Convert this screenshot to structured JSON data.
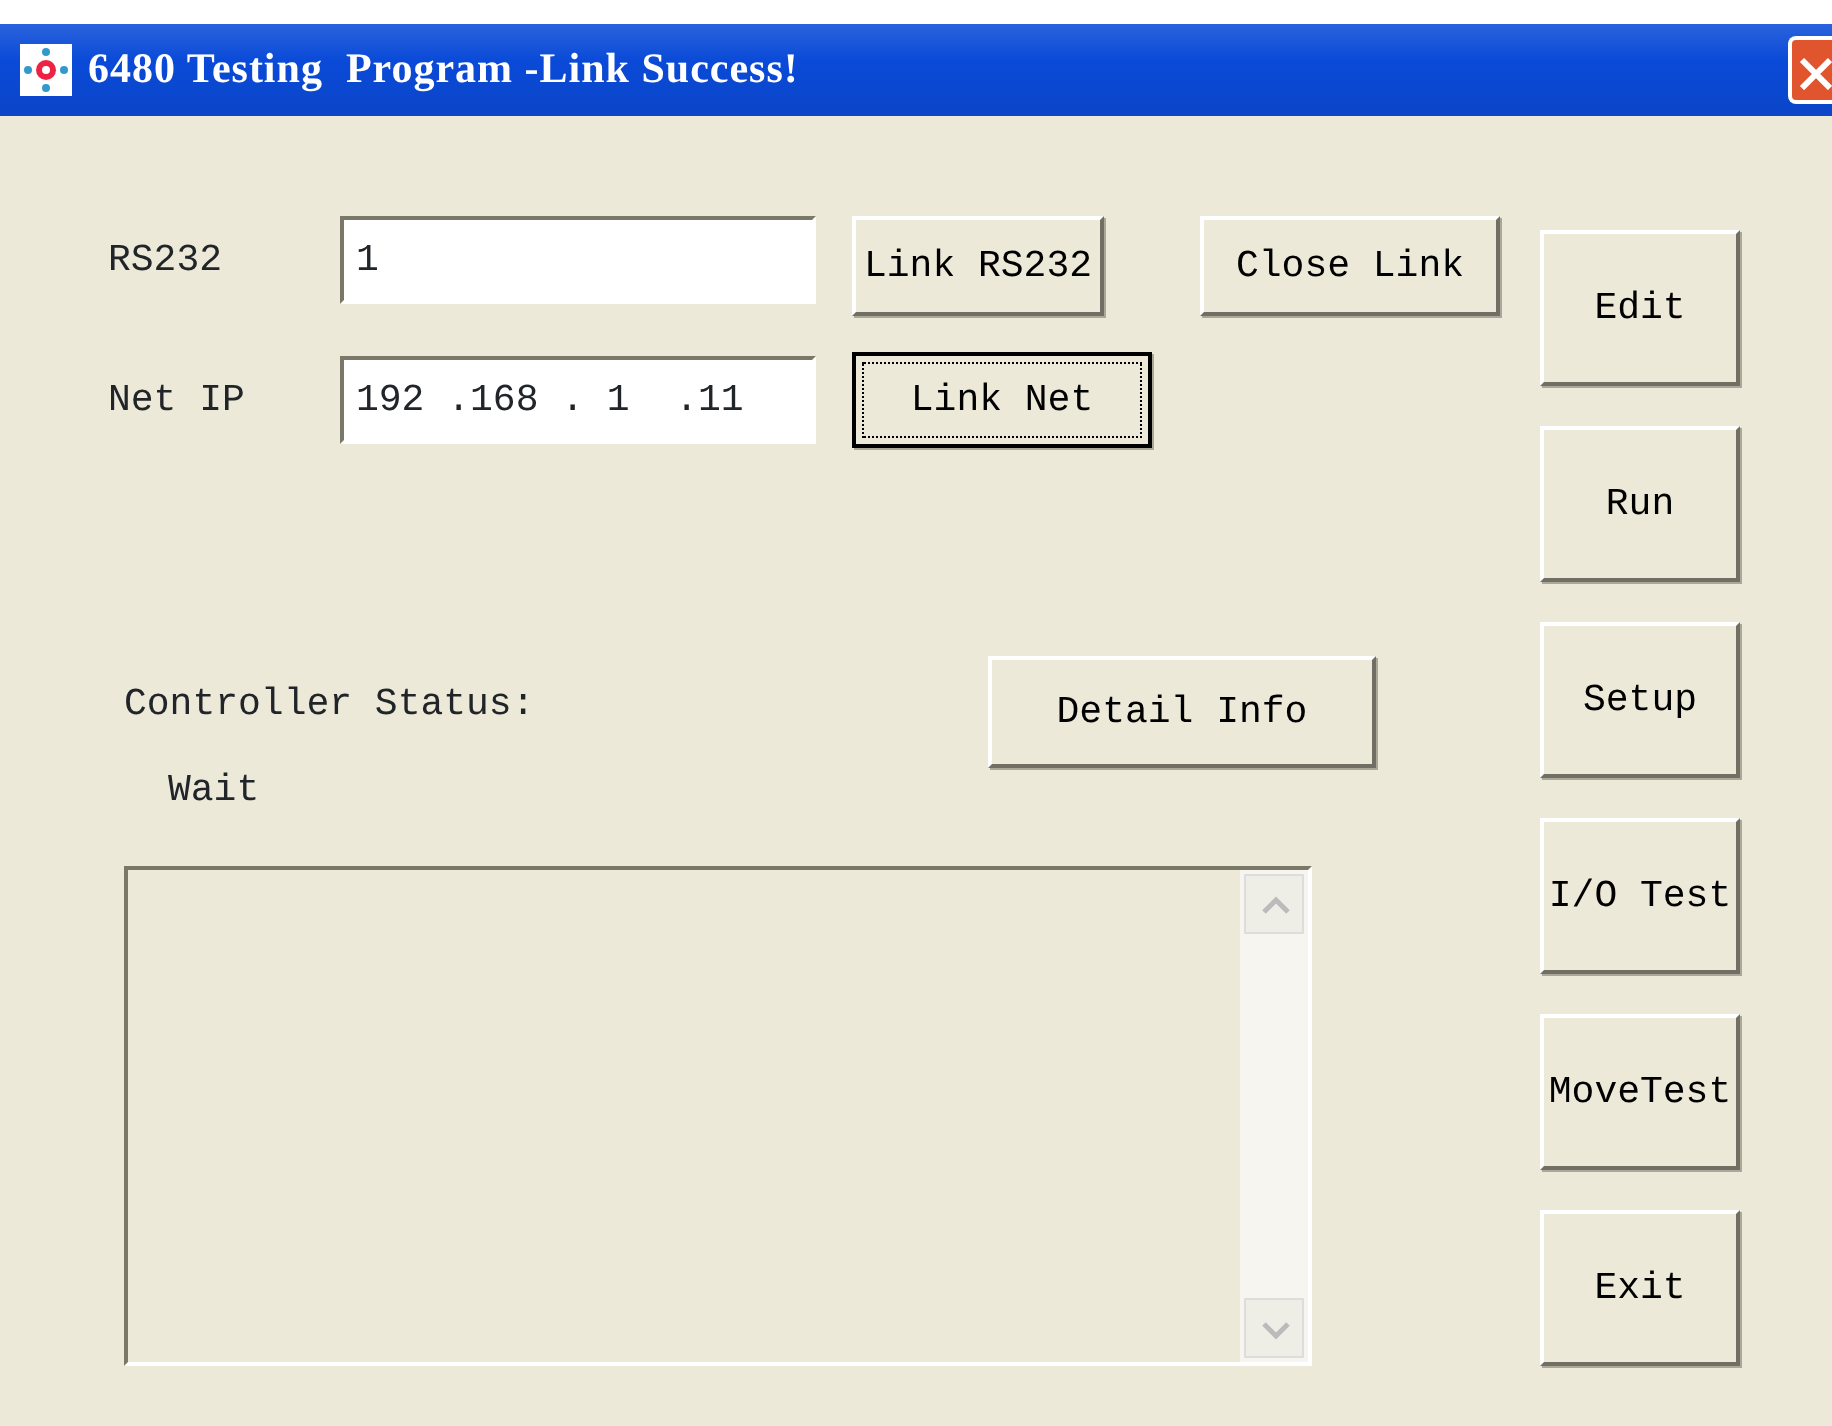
{
  "window": {
    "title": "6480 Testing  Program -Link Success!"
  },
  "connection": {
    "fields": [
      {
        "label": "RS232",
        "value": "1"
      },
      {
        "label": "Net IP",
        "value": "192 .168 . 1  .11"
      }
    ],
    "buttons": [
      {
        "label": "Link RS232",
        "focused": false
      },
      {
        "label": "Close Link",
        "focused": false
      },
      {
        "label": "Link Net",
        "focused": true
      }
    ]
  },
  "status": {
    "label": "Controller Status:",
    "value": "Wait",
    "detail_button": "Detail Info"
  },
  "side_buttons": [
    {
      "label": "Edit"
    },
    {
      "label": "Run"
    },
    {
      "label": "Setup"
    },
    {
      "label": "I/O Test"
    },
    {
      "label": "MoveTest"
    },
    {
      "label": "Exit"
    }
  ]
}
